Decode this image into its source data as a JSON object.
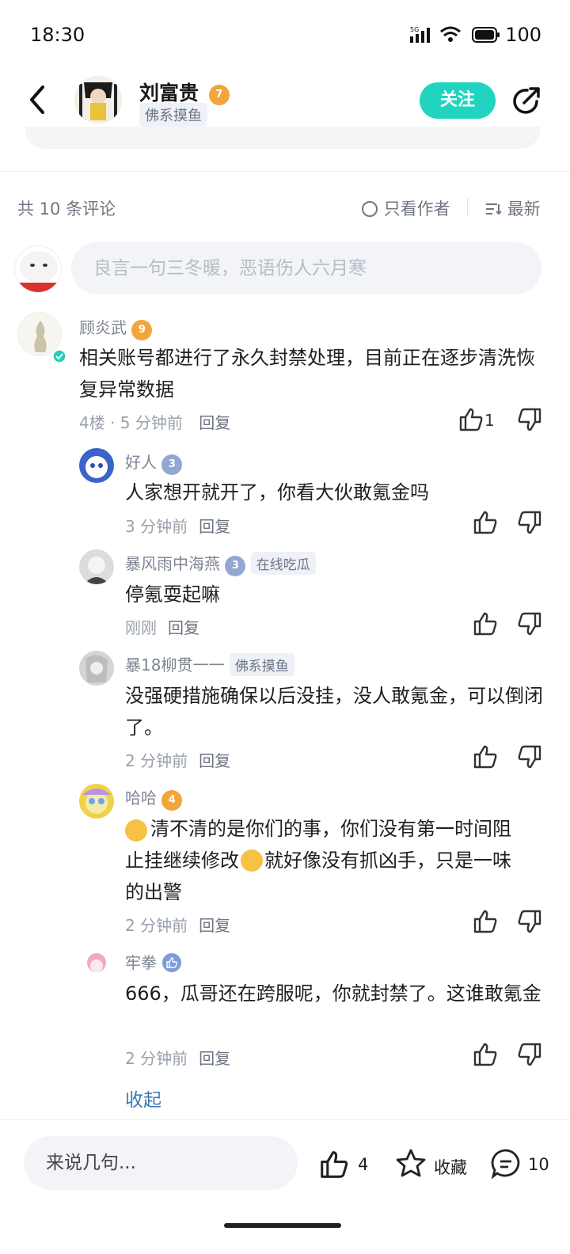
{
  "status_bar": {
    "time": "18:30",
    "signal": "5G",
    "battery": "100"
  },
  "header": {
    "username": "刘富贵",
    "level": "7",
    "tag": "佛系摸鱼",
    "follow_label": "关注"
  },
  "comments_bar": {
    "count_label": "共 10 条评论",
    "author_only_label": "只看作者",
    "sort_label": "最新"
  },
  "comment_input": {
    "placeholder": "良言一句三冬暖，恶语伤人六月寒"
  },
  "main_comment": {
    "user": "顾炎武",
    "level": "9",
    "text": "相关账号都进行了永久封禁处理，目前正在逐步清洗恢复异常数据",
    "floor_time": "4楼 · 5 分钟前",
    "reply_label": "回复",
    "likes": "1"
  },
  "replies": [
    {
      "user": "好人",
      "level": "3",
      "tag": "",
      "text": "人家想开就开了，你看大伙敢氪金吗",
      "time": "3 分钟前",
      "reply_label": "回复"
    },
    {
      "user": "暴风雨中海燕",
      "level": "3",
      "tag": "在线吃瓜",
      "text": "停氪耍起嘛",
      "time": "刚刚",
      "reply_label": "回复"
    },
    {
      "user": "暴18柳贯一一",
      "level": "",
      "tag": "佛系摸鱼",
      "text": "没强硬措施确保以后没挂，没人敢氪金，可以倒闭了。",
      "time": "2 分钟前",
      "reply_label": "回复"
    },
    {
      "user": "哈哈",
      "level": "4",
      "tag": "",
      "text_a": "清不清的是你们的事，你们没有第一时间阻",
      "text_b": "止挂继续修改",
      "text_c": "就好像没有抓凶手，只是一味",
      "text_d": "的出警",
      "time": "2 分钟前",
      "reply_label": "回复"
    },
    {
      "user": "牢拳",
      "level": "",
      "tag": "",
      "text": "666，瓜哥还在跨服呢，你就封禁了。这谁敢氪金",
      "time": "2 分钟前",
      "reply_label": "回复"
    }
  ],
  "collapse_label": "收起",
  "bottom_bar": {
    "input_placeholder": "来说几句...",
    "likes": "4",
    "favorite_label": "收藏",
    "comments": "10"
  },
  "colors": {
    "accent": "#21d4c0",
    "link": "#3b78b8",
    "level_orange": "#f2a53a"
  }
}
